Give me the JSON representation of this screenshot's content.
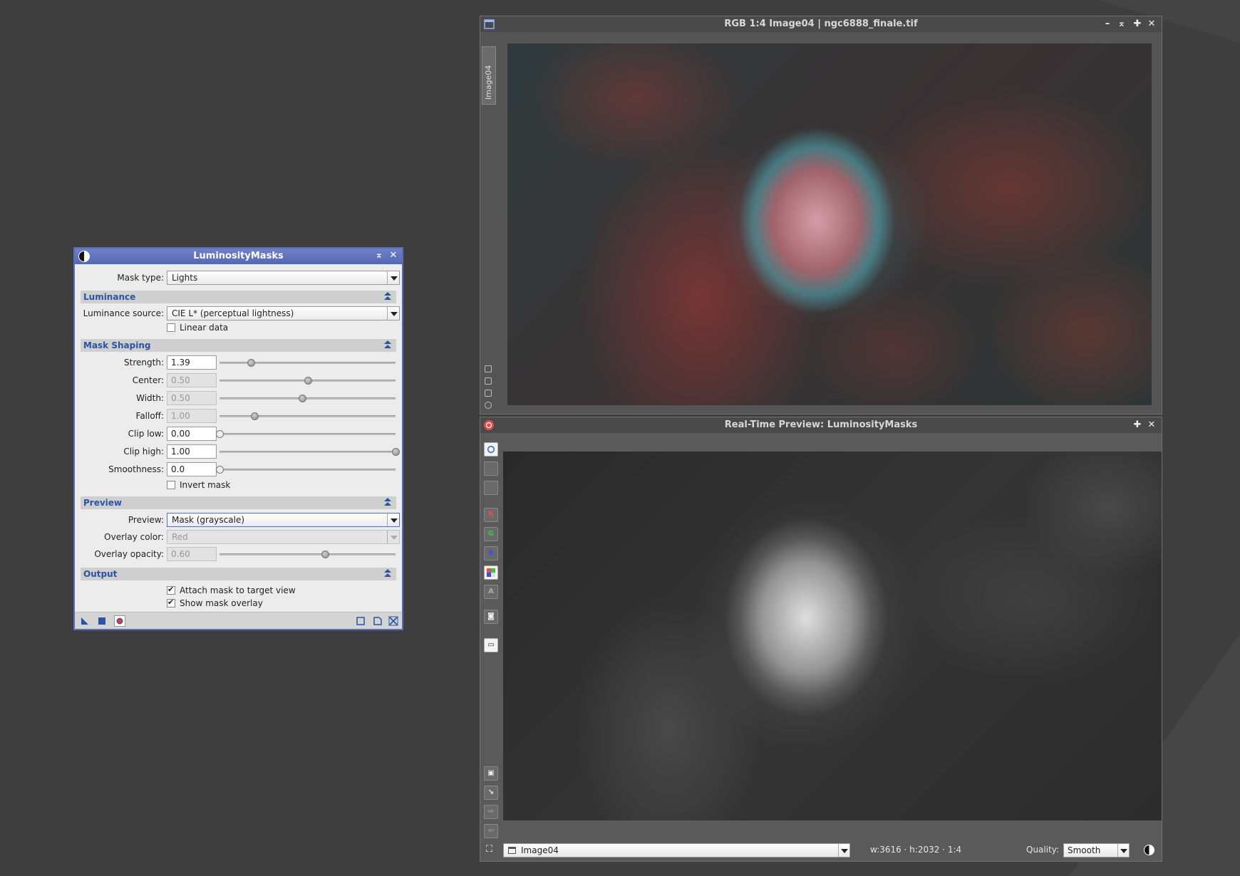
{
  "tool": {
    "title": "LuminosityMasks",
    "mask_type": {
      "label": "Mask type:",
      "value": "Lights"
    },
    "sections": {
      "luminance": "Luminance",
      "mask_shaping": "Mask Shaping",
      "preview": "Preview",
      "output": "Output"
    },
    "luminance_source": {
      "label": "Luminance source:",
      "value": "CIE L* (perceptual lightness)"
    },
    "linear_data": {
      "label": "Linear data",
      "checked": false
    },
    "params": [
      {
        "label": "Strength:",
        "value": "1.39",
        "enabled": true,
        "level": 0.178
      },
      {
        "label": "Center:",
        "value": "0.50",
        "enabled": false,
        "level": 0.5
      },
      {
        "label": "Width:",
        "value": "0.50",
        "enabled": false,
        "level": 0.47
      },
      {
        "label": "Falloff:",
        "value": "1.00",
        "enabled": false,
        "level": 0.2
      },
      {
        "label": "Clip low:",
        "value": "0.00",
        "enabled": true,
        "level": 0.0
      },
      {
        "label": "Clip high:",
        "value": "1.00",
        "enabled": true,
        "level": 1.0
      },
      {
        "label": "Smoothness:",
        "value": "0.0",
        "enabled": true,
        "level": 0.0
      }
    ],
    "invert_mask": {
      "label": "Invert mask",
      "checked": false
    },
    "preview": {
      "label": "Preview:",
      "value": "Mask (grayscale)"
    },
    "overlay_color": {
      "label": "Overlay color:",
      "value": "Red"
    },
    "overlay_opacity": {
      "label": "Overlay opacity:",
      "value": "0.60",
      "level": 0.6
    },
    "attach_mask": {
      "label": "Attach mask to target view",
      "checked": true
    },
    "show_overlay": {
      "label": "Show mask overlay",
      "checked": true
    }
  },
  "image_window": {
    "title": "RGB 1:4 Image04 | ngc6888_finale.tif",
    "side_tab": "Image04"
  },
  "preview_window": {
    "title": "Real-Time Preview: LuminosityMasks",
    "view": "Image04",
    "dims": "w:3616 · h:2032 · 1:4",
    "quality_label": "Quality:",
    "quality": "Smooth",
    "channel_buttons": [
      "R",
      "G",
      "B",
      "A"
    ]
  },
  "colors": {
    "tool_title": "#5b6db8",
    "section_text": "#2b53a3",
    "desktop": "#3e3e3e"
  }
}
